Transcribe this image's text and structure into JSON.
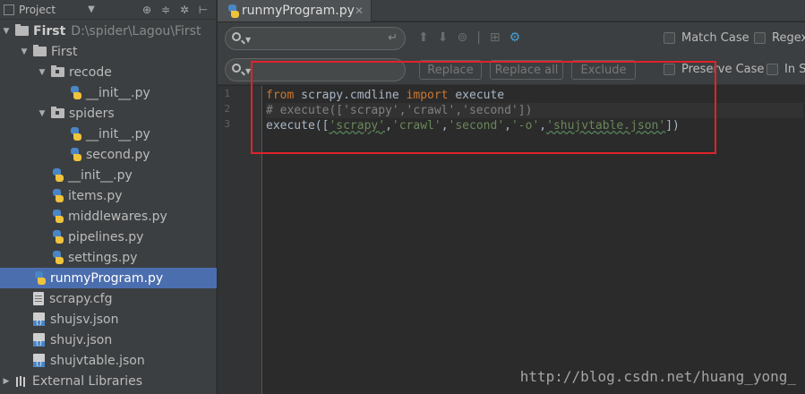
{
  "project_panel": {
    "title": "Project",
    "tree": [
      {
        "label": "First",
        "path": "D:\\spider\\Lagou\\First",
        "type": "folder",
        "level": 0,
        "expanded": true,
        "bold": true
      },
      {
        "label": "First",
        "type": "folder",
        "level": 1,
        "expanded": true
      },
      {
        "label": "recode",
        "type": "package",
        "level": 2,
        "expanded": true
      },
      {
        "label": "__init__.py",
        "type": "python",
        "level": 3
      },
      {
        "label": "spiders",
        "type": "package",
        "level": 2,
        "expanded": true
      },
      {
        "label": "__init__.py",
        "type": "python",
        "level": 3
      },
      {
        "label": "second.py",
        "type": "python",
        "level": 3
      },
      {
        "label": "__init__.py",
        "type": "python",
        "level": 2
      },
      {
        "label": "items.py",
        "type": "python",
        "level": 2
      },
      {
        "label": "middlewares.py",
        "type": "python",
        "level": 2
      },
      {
        "label": "pipelines.py",
        "type": "python",
        "level": 2
      },
      {
        "label": "settings.py",
        "type": "python",
        "level": 2
      },
      {
        "label": "runmyProgram.py",
        "type": "python",
        "level": 1,
        "selected": true
      },
      {
        "label": "scrapy.cfg",
        "type": "cfg",
        "level": 1
      },
      {
        "label": "shujsv.json",
        "type": "json",
        "level": 1
      },
      {
        "label": "shujv.json",
        "type": "json",
        "level": 1
      },
      {
        "label": "shujvtable.json",
        "type": "json",
        "level": 1
      },
      {
        "label": "External Libraries",
        "type": "library",
        "level": 0,
        "collapsed": true
      }
    ]
  },
  "editor": {
    "tab_label": "runmyProgram.py",
    "find": {
      "search_value": "",
      "replace_value": "",
      "match_case": "Match Case",
      "regex": "Regex",
      "preserve_case": "Preserve Case",
      "in_selection": "In S",
      "replace": "Replace",
      "replace_all": "Replace all",
      "exclude": "Exclude"
    },
    "line_numbers": [
      "1",
      "2",
      "3"
    ],
    "code": [
      [
        {
          "t": "from",
          "c": "kw"
        },
        {
          "t": " scrapy.cmdline ",
          "c": ""
        },
        {
          "t": "import",
          "c": "kw"
        },
        {
          "t": " execute",
          "c": ""
        }
      ],
      [
        {
          "t": "# execute(['scrapy','crawl','second'])",
          "c": "cm"
        }
      ],
      [
        {
          "t": "execute([",
          "c": ""
        },
        {
          "t": "'scrapy'",
          "c": "str-u"
        },
        {
          "t": ",",
          "c": ""
        },
        {
          "t": "'crawl'",
          "c": "str"
        },
        {
          "t": ",",
          "c": ""
        },
        {
          "t": "'second'",
          "c": "str"
        },
        {
          "t": ",",
          "c": ""
        },
        {
          "t": "'-o'",
          "c": "str"
        },
        {
          "t": ",",
          "c": ""
        },
        {
          "t": "'shujvtable.json'",
          "c": "str-u"
        },
        {
          "t": "])",
          "c": ""
        }
      ]
    ]
  },
  "watermark": "http://blog.csdn.net/huang_yong_",
  "colors": {
    "selection": "#4b6eaf",
    "highlight_box": "#e0232a",
    "keyword": "#cc7832",
    "string": "#6a8759",
    "comment": "#808080"
  }
}
